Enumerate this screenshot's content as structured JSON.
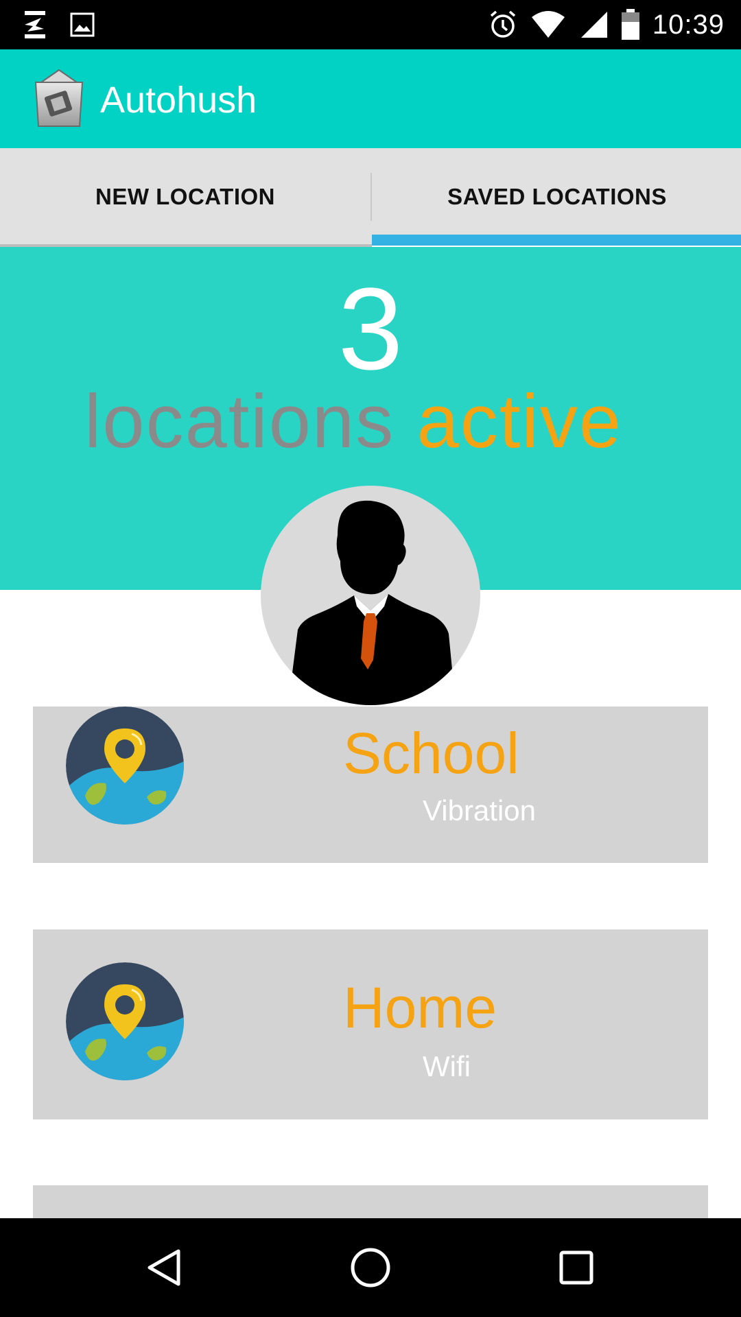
{
  "status_bar": {
    "time": "10:39",
    "icons": [
      "notification-app-icon",
      "image-icon",
      "alarm-icon",
      "wifi-icon",
      "signal-icon",
      "battery-icon"
    ]
  },
  "app_bar": {
    "title": "Autohush",
    "logo": "autohush-logo"
  },
  "tabs": {
    "new_location": "NEW LOCATION",
    "saved_locations": "SAVED LOCATIONS",
    "selected": "saved_locations",
    "indicator_color": "#33b2e3"
  },
  "hero": {
    "count": "3",
    "label_word1": "locations",
    "label_word2": "active",
    "background": "#2ad4c4",
    "accent": "#f5a312"
  },
  "locations": [
    {
      "name": "School",
      "mode": "Vibration",
      "icon": "location-globe-icon"
    },
    {
      "name": "Home",
      "mode": "Wifi",
      "icon": "location-globe-icon"
    }
  ],
  "colors": {
    "app_bar": "#02d2c3",
    "tab_bar": "#e1e1e1",
    "card": "#d3d3d3",
    "title_text": "#f5a312"
  },
  "nav_bar": {
    "icons": [
      "back-icon",
      "home-icon",
      "recents-icon"
    ]
  }
}
